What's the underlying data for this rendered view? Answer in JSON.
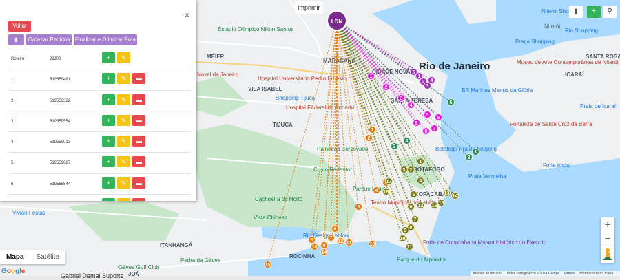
{
  "panel": {
    "back_label": "Voltar",
    "order_label": "Ordenar Pedidos",
    "finalize_label": "Finalizar e Otimizar Rota",
    "close_label": "×",
    "header_row": {
      "label": "Roteiro",
      "code": "29J00"
    },
    "rows": [
      {
        "num": "1",
        "code": "519559481"
      },
      {
        "num": "2",
        "code": "519559322"
      },
      {
        "num": "3",
        "code": "519559554"
      },
      {
        "num": "4",
        "code": "519559013"
      },
      {
        "num": "5",
        "code": "519559087"
      },
      {
        "num": "6",
        "code": "519558844"
      }
    ]
  },
  "map": {
    "print_label": "Imprimir",
    "depot_label": "LDN",
    "type_map": "Mapa",
    "type_satellite": "Satélite",
    "attribution": [
      "Atalhos do teclado",
      "Dados cartográficos ©2024 Google",
      "Termos",
      "Informar erro no mapa"
    ],
    "google_logo": "Google",
    "bottom_text": "Gabriel Demai Suporte",
    "places": [
      {
        "t": "Rio de Janeiro",
        "c": "big"
      },
      {
        "t": "MÉIER",
        "c": "bold"
      },
      {
        "t": "VILA ISABEL",
        "c": "bold"
      },
      {
        "t": "TIJUCA",
        "c": "bold"
      },
      {
        "t": "MARACANÃ",
        "c": "bold"
      },
      {
        "t": "CIDADE NOVA",
        "c": "bold"
      },
      {
        "t": "SANTA TERESA",
        "c": "bold"
      },
      {
        "t": "BOTAFOGO",
        "c": "bold"
      },
      {
        "t": "COPACABANA",
        "c": "bold"
      },
      {
        "t": "ROCINHA",
        "c": "bold"
      },
      {
        "t": "ITANHANGÁ",
        "c": "bold"
      },
      {
        "t": "JOÁ",
        "c": "bold"
      },
      {
        "t": "ICARAÍ",
        "c": "bold"
      },
      {
        "t": "SANTA ROSA",
        "c": "bold"
      },
      {
        "t": "Niterói",
        "c": ""
      },
      {
        "t": "Niterói Shopping",
        "c": "poi-blue"
      },
      {
        "t": "Praça Shopping",
        "c": "poi-blue"
      },
      {
        "t": "Museu de Arte Contemporânea de Niterói",
        "c": "poi-red"
      },
      {
        "t": "Estádio Olímpico Nilton Santos",
        "c": "poi-green"
      },
      {
        "t": "Naval de Janeiro",
        "c": "poi-red"
      },
      {
        "t": "Hospital Universitário Pedro Ernesto",
        "c": "poi-red"
      },
      {
        "t": "Shopping Tijuca",
        "c": "poi-blue"
      },
      {
        "t": "Hospital Federal de Andaraí",
        "c": "poi-red"
      },
      {
        "t": "Cristo Redentor",
        "c": "poi-green"
      },
      {
        "t": "Paineiras Corcovado",
        "c": "poi-green"
      },
      {
        "t": "Cachoeira do Horto",
        "c": "poi-green"
      },
      {
        "t": "Vista Chinesa",
        "c": "poi-green"
      },
      {
        "t": "Parque Lage",
        "c": "poi-green"
      },
      {
        "t": "Fortaleza de Santa Cruz da Barra",
        "c": "poi-red"
      },
      {
        "t": "Forte Imbuí",
        "c": "poi-blue"
      },
      {
        "t": "Praia Vermelha",
        "c": "poi-blue"
      },
      {
        "t": "Praia de Icaraí",
        "c": "poi-blue"
      },
      {
        "t": "Botafogo Praia Shopping",
        "c": "poi-blue"
      },
      {
        "t": "Forte de Copacabana Museu Histórico do Exército",
        "c": "poi-purple"
      },
      {
        "t": "Parque do Arpoador",
        "c": "poi-green"
      },
      {
        "t": "Pedra da Gávea",
        "c": "poi-green"
      },
      {
        "t": "Gávea Golf Club",
        "c": "poi-green"
      },
      {
        "t": "Vivian Festas",
        "c": "poi-blue"
      },
      {
        "t": "Rio Design Leblon",
        "c": "poi-blue"
      },
      {
        "t": "Teatro Municipal do Leblon",
        "c": "poi-red"
      },
      {
        "t": "BR Marinas Marina da Glória",
        "c": "poi-blue"
      },
      {
        "t": "Rio Shopping",
        "c": "poi-blue"
      }
    ]
  },
  "colors": {
    "depot": "#7b2a8c",
    "route_purple": "#9b2fae",
    "route_magenta": "#d81bd3",
    "route_orange": "#e07b12",
    "route_olive": "#7b7b1a",
    "route_green": "#2e8b57",
    "water": "#aadaff",
    "land": "#eef0f2",
    "park": "#c8e6c9"
  }
}
